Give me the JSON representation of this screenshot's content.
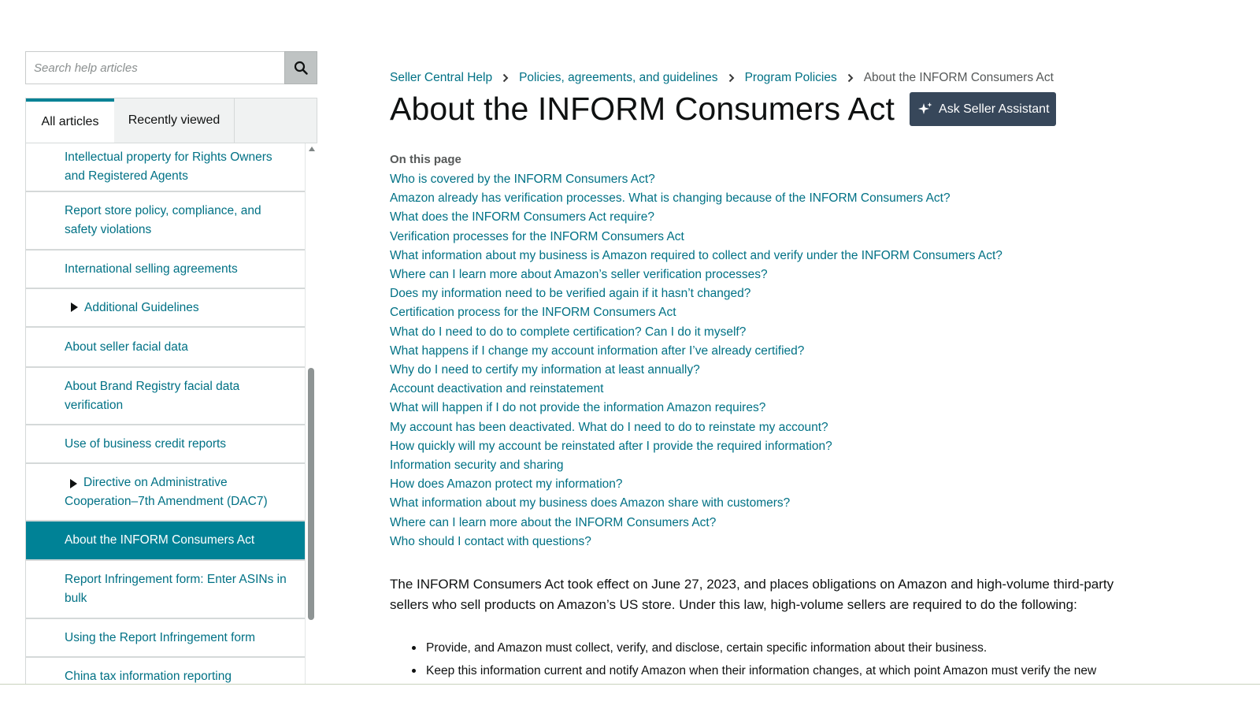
{
  "search": {
    "placeholder": "Search help articles"
  },
  "sidebar": {
    "tabs": [
      {
        "label": "All articles",
        "active": true
      },
      {
        "label": "Recently viewed",
        "active": false
      }
    ],
    "items": [
      {
        "label": "Intellectual property for Rights Owners and Registered Agents"
      },
      {
        "label": "Report store policy, compliance, and safety violations"
      },
      {
        "label": "International selling agreements"
      },
      {
        "label": "Additional Guidelines",
        "expandable": true
      },
      {
        "label": "About seller facial data"
      },
      {
        "label": "About Brand Registry facial data verification"
      },
      {
        "label": "Use of business credit reports"
      },
      {
        "label": "Directive on Administrative Cooperation–7th Amendment (DAC7)",
        "expandable": true
      },
      {
        "label": "About the INFORM Consumers Act",
        "active": true
      },
      {
        "label": "Report Infringement form: Enter ASINs in bulk"
      },
      {
        "label": "Using the Report Infringement form"
      },
      {
        "label": "China tax information reporting"
      }
    ]
  },
  "breadcrumb": {
    "items": [
      "Seller Central Help",
      "Policies, agreements, and guidelines",
      "Program Policies"
    ],
    "current": "About the INFORM Consumers Act"
  },
  "page": {
    "title": "About the INFORM Consumers Act",
    "ask_button": "Ask Seller Assistant",
    "on_this_page": "On this page",
    "toc": [
      "Who is covered by the INFORM Consumers Act?",
      "Amazon already has verification processes. What is changing because of the INFORM Consumers Act?",
      "What does the INFORM Consumers Act require?",
      "Verification processes for the INFORM Consumers Act",
      "What information about my business is Amazon required to collect and verify under the INFORM Consumers Act?",
      "Where can I learn more about Amazon’s seller verification processes?",
      "Does my information need to be verified again if it hasn’t changed?",
      "Certification process for the INFORM Consumers Act",
      "What do I need to do to complete certification? Can I do it myself?",
      "What happens if I change my account information after I’ve already certified?",
      "Why do I need to certify my information at least annually?",
      "Account deactivation and reinstatement",
      "What will happen if I do not provide the information Amazon requires?",
      "My account has been deactivated. What do I need to do to reinstate my account?",
      "How quickly will my account be reinstated after I provide the required information?",
      "Information security and sharing",
      "How does Amazon protect my information?",
      "What information about my business does Amazon share with customers?",
      "Where can I learn more about the INFORM Consumers Act?",
      "Who should I contact with questions?"
    ],
    "intro": "The INFORM Consumers Act took effect on June 27, 2023, and places obligations on Amazon and high-volume third-party sellers who sell products on Amazon’s US store. Under this law, high-volume sellers are required to do the following:",
    "bullets": [
      "Provide, and Amazon must collect, verify, and disclose, certain specific information about their business.",
      "Keep this information current and notify Amazon when their information changes, at which point Amazon must verify the new"
    ]
  },
  "colors": {
    "link": "#007185",
    "active_nav": "#008296",
    "assistant_button": "#37475a"
  },
  "icons": [
    "search-icon",
    "chevron-right-icon",
    "sparkle-icon",
    "triangle-right-icon",
    "scroll-up-icon"
  ]
}
